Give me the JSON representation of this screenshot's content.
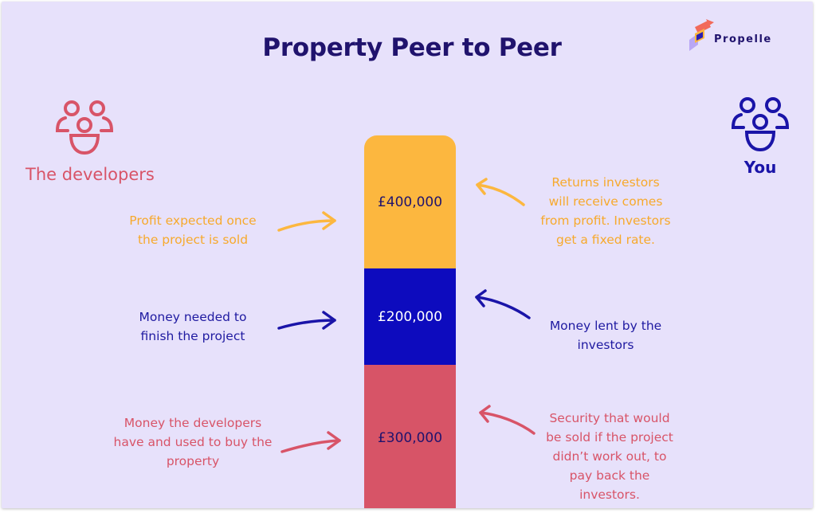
{
  "title": "Property Peer to Peer",
  "brand": {
    "name": "Propelle"
  },
  "parties": {
    "developers": {
      "label": "The developers",
      "icon": "group-icon",
      "color": "#d85468"
    },
    "you": {
      "label": "You",
      "icon": "group-icon",
      "color": "#1a14a8"
    }
  },
  "stack": [
    {
      "amount": "£400,000",
      "color": "#fcb73f"
    },
    {
      "amount": "£200,000",
      "color": "#0d0bbe"
    },
    {
      "amount": "£300,000",
      "color": "#d75467"
    }
  ],
  "left_notes": {
    "profit": "Profit expected once the project is sold",
    "needed": "Money needed to finish the project",
    "developers_money": "Money the developers have and used to buy the property"
  },
  "right_notes": {
    "returns": "Returns investors will receive comes from profit. Investors get a fixed rate.",
    "lent": "Money lent by the investors",
    "security": "Security that would be sold if the project didn’t work out, to pay back the investors."
  }
}
